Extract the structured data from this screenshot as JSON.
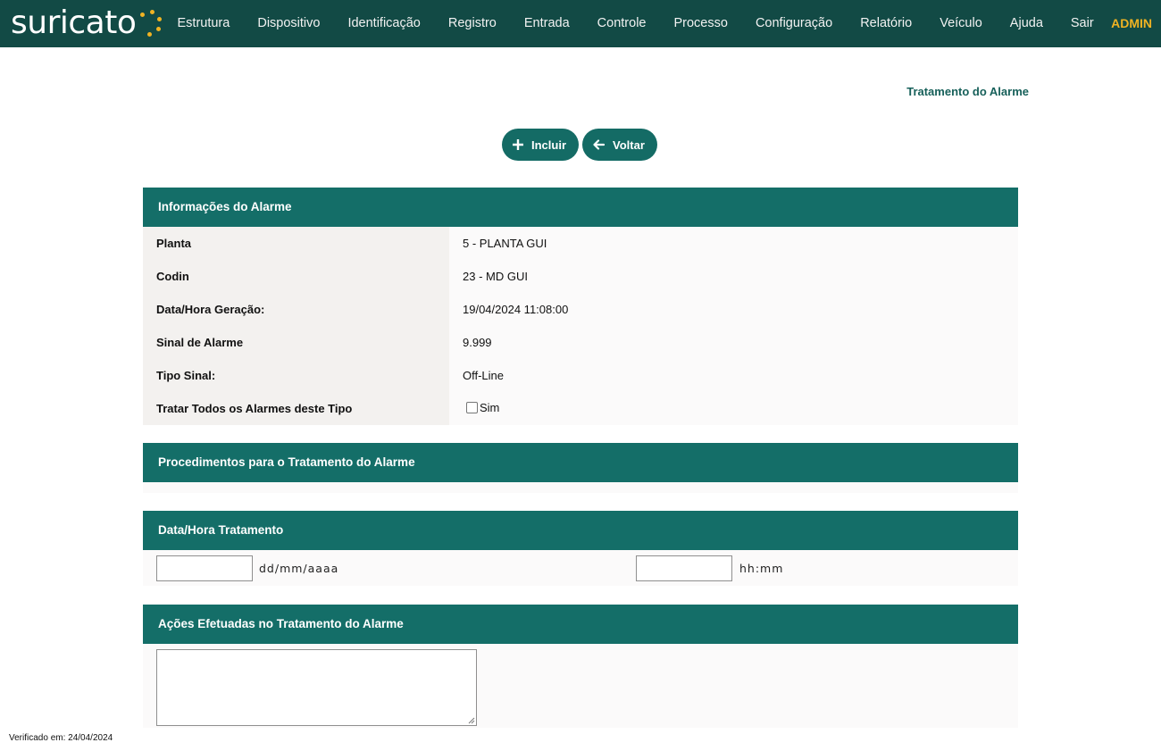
{
  "app": {
    "logo_text": "suricato",
    "user": "ADMIN"
  },
  "nav": [
    "Estrutura",
    "Dispositivo",
    "Identificação",
    "Registro",
    "Entrada",
    "Controle",
    "Processo",
    "Configuração",
    "Relatório",
    "Veículo",
    "Ajuda",
    "Sair"
  ],
  "page": {
    "title": "Tratamento do Alarme"
  },
  "toolbar": {
    "add_label": "Incluir",
    "back_label": "Voltar"
  },
  "info": {
    "header": "Informações do Alarme",
    "rows": [
      {
        "label": "Planta",
        "value": "5 - PLANTA GUI"
      },
      {
        "label": "Codin",
        "value": "23 - MD GUI"
      },
      {
        "label": "Data/Hora Geração:",
        "value": "19/04/2024 11:08:00"
      },
      {
        "label": "Sinal de Alarme",
        "value": "9.999"
      },
      {
        "label": "Tipo Sinal:",
        "value": "Off-Line"
      },
      {
        "label": "Tratar Todos os Alarmes deste Tipo",
        "checkbox_label": "Sim",
        "checked": false
      }
    ]
  },
  "procedures": {
    "header": "Procedimentos para o Tratamento do Alarme"
  },
  "treatment": {
    "header": "Data/Hora Tratamento",
    "date_value": "",
    "date_hint": "dd/mm/aaaa",
    "time_value": "",
    "time_hint": "hh:mm"
  },
  "actions_section": {
    "header": "Ações Efetuadas no Tratamento do Alarme",
    "value": ""
  },
  "footer": {
    "verified": "Verificado em: 24/04/2024"
  },
  "colors": {
    "topbar": "#124a45",
    "accent": "#146e68",
    "user": "#f0b323",
    "logo_dots": "#f0b323"
  },
  "icons": {
    "add": "plus-icon",
    "back": "arrow-left-icon"
  }
}
